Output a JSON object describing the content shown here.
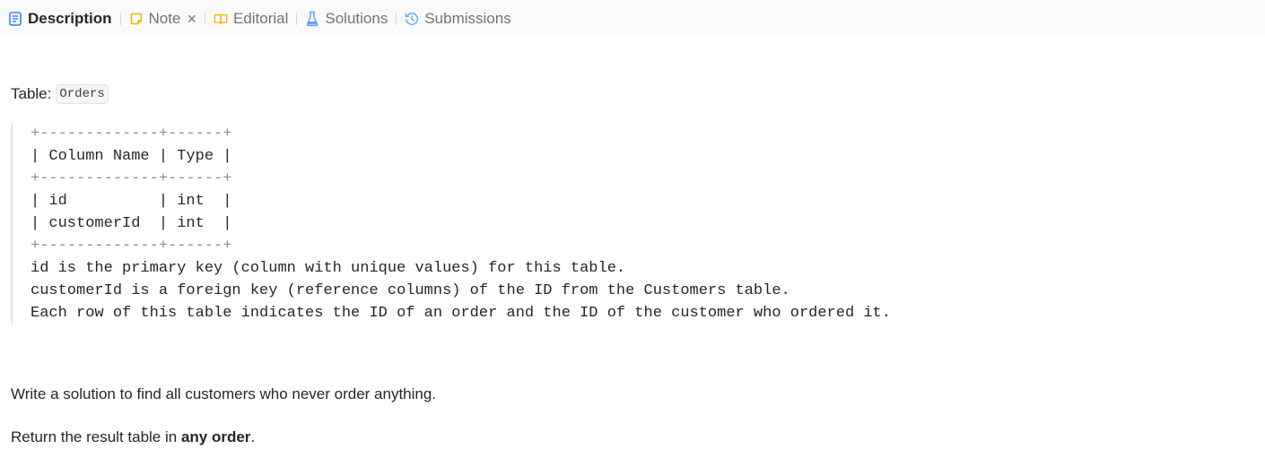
{
  "tabs": [
    {
      "label": "Description",
      "icon": "description-icon",
      "active": true
    },
    {
      "label": "Note",
      "icon": "note-icon",
      "active": false,
      "closable": true
    },
    {
      "label": "Editorial",
      "icon": "book-icon",
      "active": false
    },
    {
      "label": "Solutions",
      "icon": "flask-icon",
      "active": false
    },
    {
      "label": "Submissions",
      "icon": "history-icon",
      "active": false
    }
  ],
  "content": {
    "table_prefix": "Table:",
    "table_name": "Orders",
    "schema_lines": [
      "+-------------+------+",
      "| Column Name | Type |",
      "+-------------+------+",
      "| id          | int  |",
      "| customerId  | int  |",
      "+-------------+------+",
      "id is the primary key (column with unique values) for this table.",
      "customerId is a foreign key (reference columns) of the ID from the Customers table.",
      "Each row of this table indicates the ID of an order and the ID of the customer who ordered it."
    ],
    "task": "Write a solution to find all customers who never order anything.",
    "return_prefix": "Return the result table in ",
    "return_bold": "any order",
    "return_suffix": "."
  },
  "colors": {
    "description_icon": "#3b82f6",
    "note_icon": "#f5b400",
    "editorial_icon": "#f5b400",
    "solutions_icon": "#60a5fa",
    "submissions_icon": "#60a5fa"
  }
}
